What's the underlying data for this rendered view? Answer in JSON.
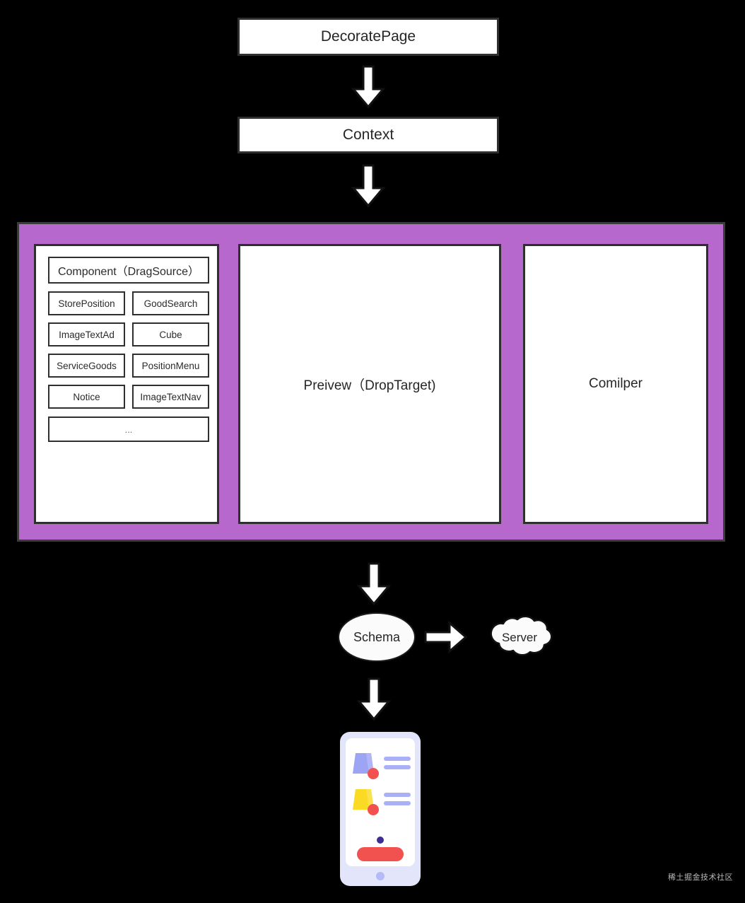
{
  "diagram": {
    "background_color": "#000000",
    "nodes": {
      "decorate_page": "DecoratePage",
      "context": "Context",
      "schema": "Schema",
      "server": "Server"
    },
    "editor": {
      "container_color": "#b768cd",
      "panels": {
        "component": {
          "header": "Component（DragSource）",
          "items": [
            "StorePosition",
            "GoodSearch",
            "ImageTextAd",
            "Cube",
            "ServiceGoods",
            "PositionMenu",
            "Notice",
            "ImageTextNav"
          ],
          "more": "..."
        },
        "preview": "Preivew（DropTarget)",
        "compiler": "Comilper"
      }
    },
    "arrows": [
      {
        "name": "decorate-to-context",
        "direction": "down"
      },
      {
        "name": "context-to-editor",
        "direction": "down"
      },
      {
        "name": "editor-to-schema",
        "direction": "down"
      },
      {
        "name": "schema-to-server",
        "direction": "right"
      },
      {
        "name": "schema-to-phone",
        "direction": "down"
      }
    ],
    "phone_preview": {
      "frame_color": "#e3e6fb",
      "screen_color": "#ffffff",
      "accent_purple": "#9ea4f4",
      "accent_yellow": "#fada22",
      "accent_red": "#f1514f",
      "accent_dark": "#3b2f91"
    }
  },
  "watermark": "稀土掘金技术社区"
}
